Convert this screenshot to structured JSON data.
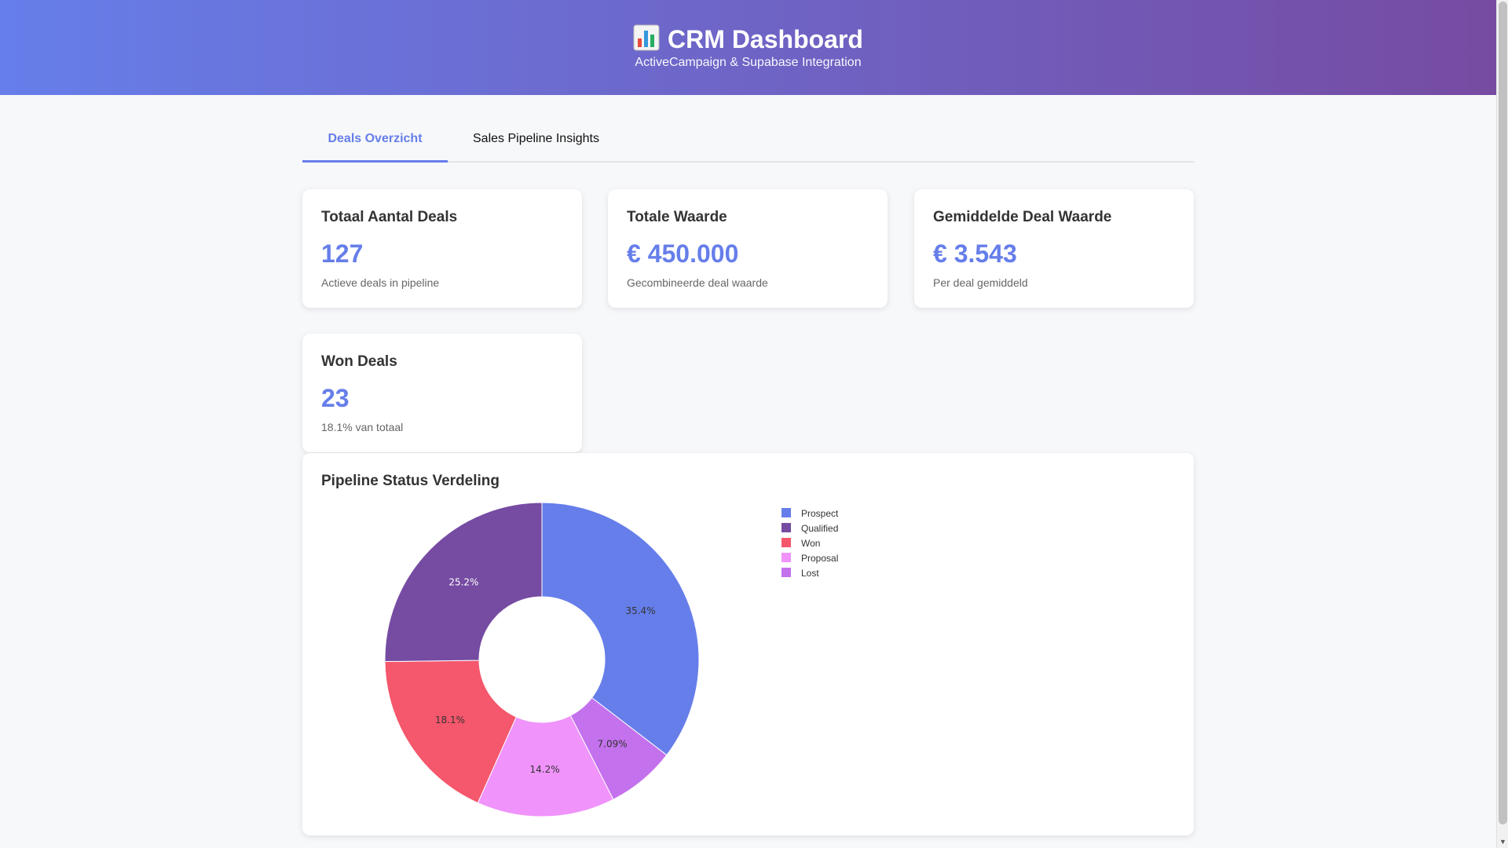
{
  "header": {
    "title": "CRM Dashboard",
    "subtitle": "ActiveCampaign & Supabase Integration",
    "icon": "bar-chart-emoji-icon"
  },
  "tabs": [
    {
      "label": "Deals Overzicht",
      "active": true
    },
    {
      "label": "Sales Pipeline Insights",
      "active": false
    }
  ],
  "cards": [
    {
      "title": "Totaal Aantal Deals",
      "value": "127",
      "desc": "Actieve deals in pipeline"
    },
    {
      "title": "Totale Waarde",
      "value": "€ 450.000",
      "desc": "Gecombineerde deal waarde"
    },
    {
      "title": "Gemiddelde Deal Waarde",
      "value": "€ 3.543",
      "desc": "Per deal gemiddeld"
    },
    {
      "title": "Won Deals",
      "value": "23",
      "desc": "18.1% van totaal"
    }
  ],
  "colors": {
    "accent": "#667eea",
    "header_gradient_start": "#667eea",
    "header_gradient_end": "#764ba2"
  },
  "chart_data": {
    "type": "pie",
    "title": "Pipeline Status Verdeling",
    "hole": true,
    "legend_position": "right",
    "slices": [
      {
        "label": "Prospect",
        "value": 35.4,
        "display": "35.4%",
        "color": "#667eea"
      },
      {
        "label": "Qualified",
        "value": 25.2,
        "display": "25.2%",
        "color": "#764ba2"
      },
      {
        "label": "Won",
        "value": 18.1,
        "display": "18.1%",
        "color": "#f5576c"
      },
      {
        "label": "Proposal",
        "value": 14.2,
        "display": "14.2%",
        "color": "#f093fb"
      },
      {
        "label": "Lost",
        "value": 7.09,
        "display": "7.09%",
        "color": "#c471ed"
      }
    ],
    "draw_order": [
      "Prospect",
      "Lost",
      "Proposal",
      "Won",
      "Qualified"
    ]
  }
}
